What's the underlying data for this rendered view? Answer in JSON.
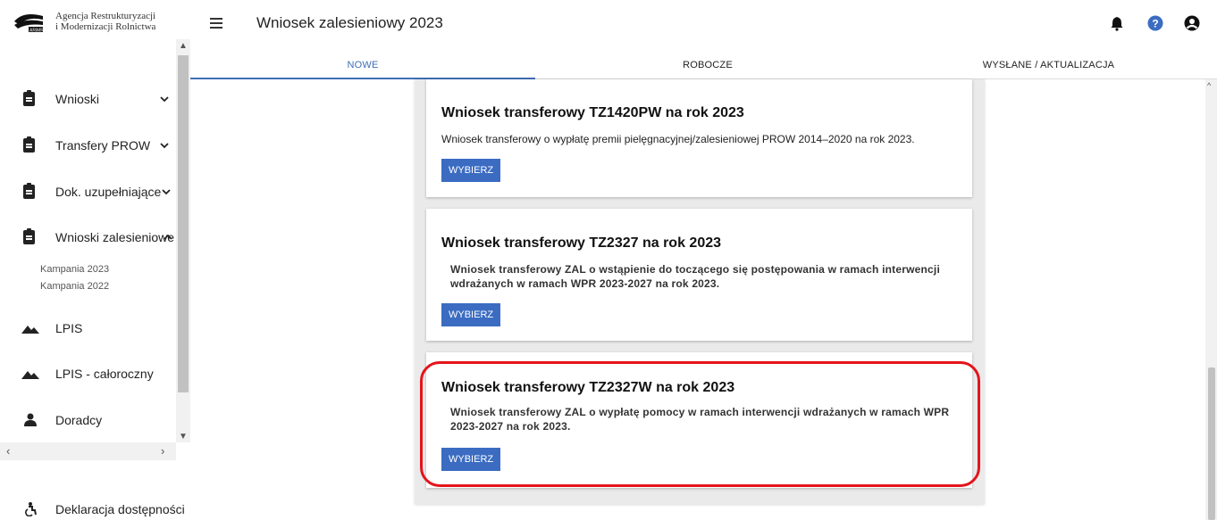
{
  "logo": {
    "line1": "Agencja Restrukturyzacji",
    "line2": "i Modernizacji Rolnictwa",
    "mark_text": "ARiMR"
  },
  "sidebar": {
    "items": [
      {
        "label": "Wnioski",
        "icon": "clipboard-icon",
        "expanded": false
      },
      {
        "label": "Transfery PROW",
        "icon": "clipboard-icon",
        "expanded": false
      },
      {
        "label": "Dok. uzupełniające",
        "icon": "clipboard-icon",
        "expanded": false
      },
      {
        "label": "Wnioski zalesieniowe",
        "icon": "clipboard-icon",
        "expanded": true
      },
      {
        "label": "LPIS",
        "icon": "mountain-icon"
      },
      {
        "label": "LPIS - całoroczny",
        "icon": "mountain-icon"
      },
      {
        "label": "Doradcy",
        "icon": "person-icon"
      }
    ],
    "subitems": [
      "Kampania 2023",
      "Kampania 2022"
    ],
    "accessibility": {
      "label": "Deklaracja dostępności",
      "icon": "accessibility-icon"
    }
  },
  "header": {
    "title": "Wniosek zalesieniowy 2023",
    "icons": [
      "bell-icon",
      "help-icon",
      "account-icon"
    ]
  },
  "tabs": [
    {
      "label": "NOWE",
      "active": true
    },
    {
      "label": "ROBOCZE",
      "active": false
    },
    {
      "label": "WYSŁANE / AKTUALIZACJA",
      "active": false
    }
  ],
  "cards": [
    {
      "title": "Wniosek transferowy TZ1420PW na rok 2023",
      "description": "Wniosek transferowy o wypłatę premii pielęgnacyjnej/zalesieniowej PROW 2014–2020 na rok 2023.",
      "button": "WYBIERZ"
    },
    {
      "title": "Wniosek transferowy TZ2327 na rok 2023",
      "description": "Wniosek transferowy ZAL o wstąpienie do toczącego się postępowania w ramach interwencji wdrażanych w ramach WPR 2023-2027 na rok 2023.",
      "button": "WYBIERZ"
    },
    {
      "title": "Wniosek transferowy TZ2327W na rok 2023",
      "description": "Wniosek transferowy ZAL o wypłatę pomocy w ramach interwencji wdrażanych w ramach WPR 2023-2027 na rok 2023.",
      "button": "WYBIERZ",
      "highlighted": true
    }
  ],
  "colors": {
    "accent": "#3f6fb6",
    "button": "#3b6cc2",
    "highlight": "#e4141b",
    "help": "#3b6cc2"
  }
}
